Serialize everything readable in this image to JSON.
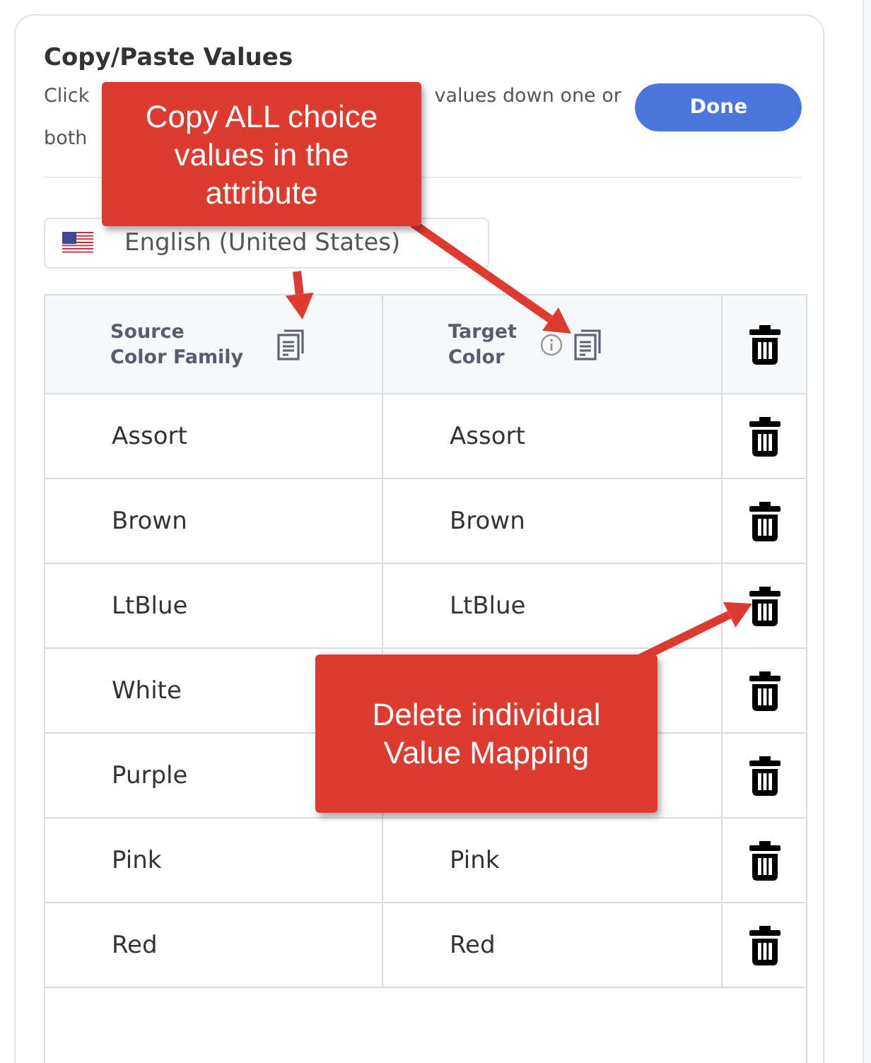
{
  "panel": {
    "title": "Copy/Paste Values",
    "description_fragments": [
      "Click",
      "values down one or",
      "both"
    ],
    "done_button": "Done",
    "language": "English (United States)"
  },
  "table": {
    "columns": [
      {
        "label": "Source\nColor Family",
        "info": false
      },
      {
        "label": "Target\nColor",
        "info": true
      }
    ],
    "rows": [
      {
        "source": "Assort",
        "target": "Assort"
      },
      {
        "source": "Brown",
        "target": "Brown"
      },
      {
        "source": "LtBlue",
        "target": "LtBlue"
      },
      {
        "source": "White"
      },
      {
        "source": "Purple"
      },
      {
        "source": "Pink",
        "target": "Pink"
      },
      {
        "source": "Red",
        "target": "Red"
      }
    ]
  },
  "callouts": [
    {
      "text": "Copy ALL choice values in the attribute"
    },
    {
      "text": "Delete individual Value Mapping"
    }
  ]
}
